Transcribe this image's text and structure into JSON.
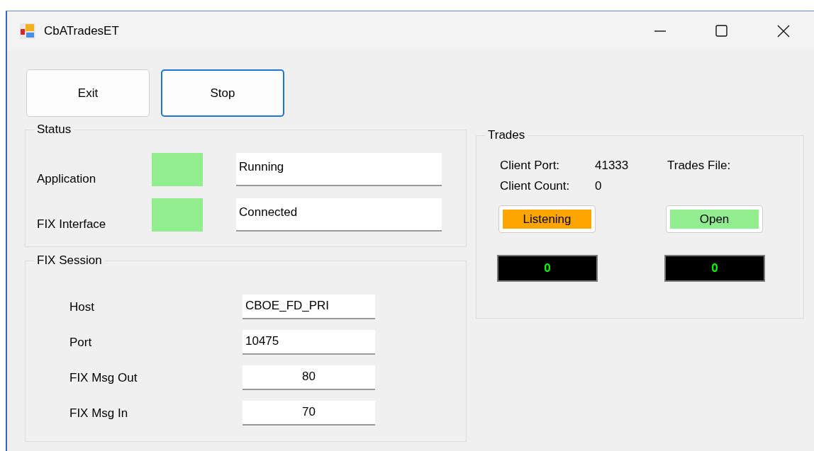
{
  "window": {
    "title": "CbATradesET"
  },
  "buttons": [
    {
      "label": "Exit",
      "focused": false
    },
    {
      "label": "Stop",
      "focused": true
    }
  ],
  "status": {
    "title": "Status",
    "rows": [
      {
        "label": "Application",
        "color": "#90ee90",
        "value": "Running"
      },
      {
        "label": "FIX Interface",
        "color": "#90ee90",
        "value": "Connected"
      }
    ]
  },
  "fix_session": {
    "title": "FIX Session",
    "fields": [
      {
        "label": "Host",
        "value": "CBOE_FD_PRI",
        "kind": "text"
      },
      {
        "label": "Port",
        "value": "10475",
        "kind": "text"
      },
      {
        "label": "FIX Msg Out",
        "value": "80",
        "kind": "counter"
      },
      {
        "label": "FIX Msg In",
        "value": "70",
        "kind": "counter"
      }
    ]
  },
  "trades": {
    "title": "Trades",
    "client_port_label": "Client Port:",
    "client_port": "41333",
    "trades_file_label": "Trades File:",
    "client_count_label": "Client Count:",
    "client_count": "0",
    "indicators": [
      {
        "label": "Listening",
        "color": "#ffa500"
      },
      {
        "label": "Open",
        "color": "#90ee90"
      }
    ],
    "counters": [
      "0",
      "0"
    ]
  }
}
